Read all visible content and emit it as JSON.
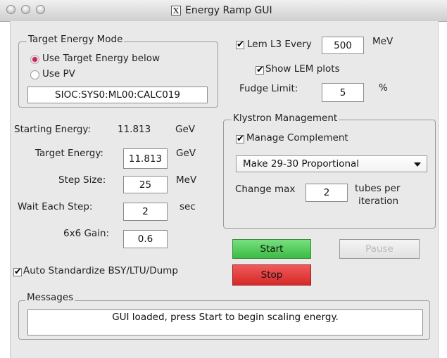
{
  "window": {
    "title": "Energy Ramp GUI",
    "app_icon": "x11-icon"
  },
  "target_mode": {
    "legend": "Target Energy Mode",
    "radio_target": "Use Target Energy below",
    "radio_pv": "Use PV",
    "selected": "Use Target Energy below",
    "pv_value": "SIOC:SYS0:ML00:CALC019"
  },
  "energy": {
    "starting_label": "Starting Energy:",
    "starting_value": "11.813",
    "starting_unit": "GeV",
    "target_label": "Target Energy:",
    "target_value": "11.813",
    "target_unit": "GeV",
    "step_label": "Step Size:",
    "step_value": "25",
    "step_unit": "MeV",
    "wait_label": "Wait Each Step:",
    "wait_value": "2",
    "wait_unit": "sec",
    "gain_label": "6x6 Gain:",
    "gain_value": "0.6"
  },
  "lem": {
    "every_label": "Lem L3 Every",
    "every_checked": true,
    "every_value": "500",
    "every_unit": "MeV",
    "show_plots_label": "Show LEM plots",
    "show_plots_checked": true,
    "fudge_label": "Fudge Limit:",
    "fudge_value": "5",
    "fudge_unit": "%"
  },
  "klystron": {
    "legend": "Klystron Management",
    "manage_label": "Manage Complement",
    "manage_checked": true,
    "mode_selected": "Make 29-30 Proportional",
    "change_max_label": "Change max",
    "change_max_value": "2",
    "tubes_line1": "tubes per",
    "tubes_line2": "iteration"
  },
  "buttons": {
    "start": "Start",
    "pause": "Pause",
    "stop": "Stop",
    "start_color": "#43c84d",
    "stop_color": "#dc2f2f"
  },
  "auto_standardize": {
    "label": "Auto Standardize BSY/LTU/Dump",
    "checked": true
  },
  "messages": {
    "legend": "Messages",
    "text": "GUI loaded, press Start to begin scaling energy."
  }
}
